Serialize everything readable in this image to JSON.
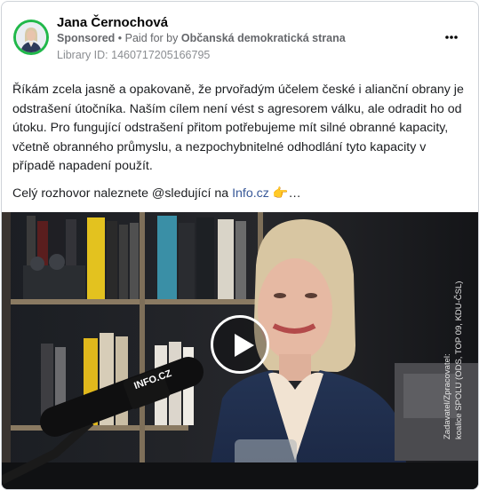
{
  "post": {
    "author_name": "Jana Černochová",
    "sponsored_label": "Sponsored",
    "separator": " • ",
    "paid_for_prefix": "Paid for by ",
    "payer": "Občanská demokratická strana",
    "library_id": "Library ID: 1460717205166795",
    "more_icon": "more-horizontal-icon",
    "body": "Říkám zcela jasně a opakovaně, že prvořadým účelem české i alianční obrany je odstrašení útočníka. Naším cílem není vést s agresorem válku, ale odradit ho od útoku. Pro fungující odstrašení přitom potřebujeme mít silné obranné kapacity, včetně obranného průmyslu, a nezpochybnitelné odhodlání tyto kapacity v případě napadení použít.",
    "cta_text": "Celý rozhovor naleznete @sledující na ",
    "cta_link": "Info.cz",
    "cta_suffix": " 👉…"
  },
  "video": {
    "overlay_line1": "Zadavatel/Zpracovatel:",
    "overlay_line2": "koalice SPOLU (ODS, TOP 09, KDU-ČSL)",
    "mic_brand": "INFO.CZ",
    "play_icon": "play-icon"
  },
  "colors": {
    "avatar_ring": "#20b84a",
    "link": "#385898",
    "meta_text": "#65676b"
  }
}
